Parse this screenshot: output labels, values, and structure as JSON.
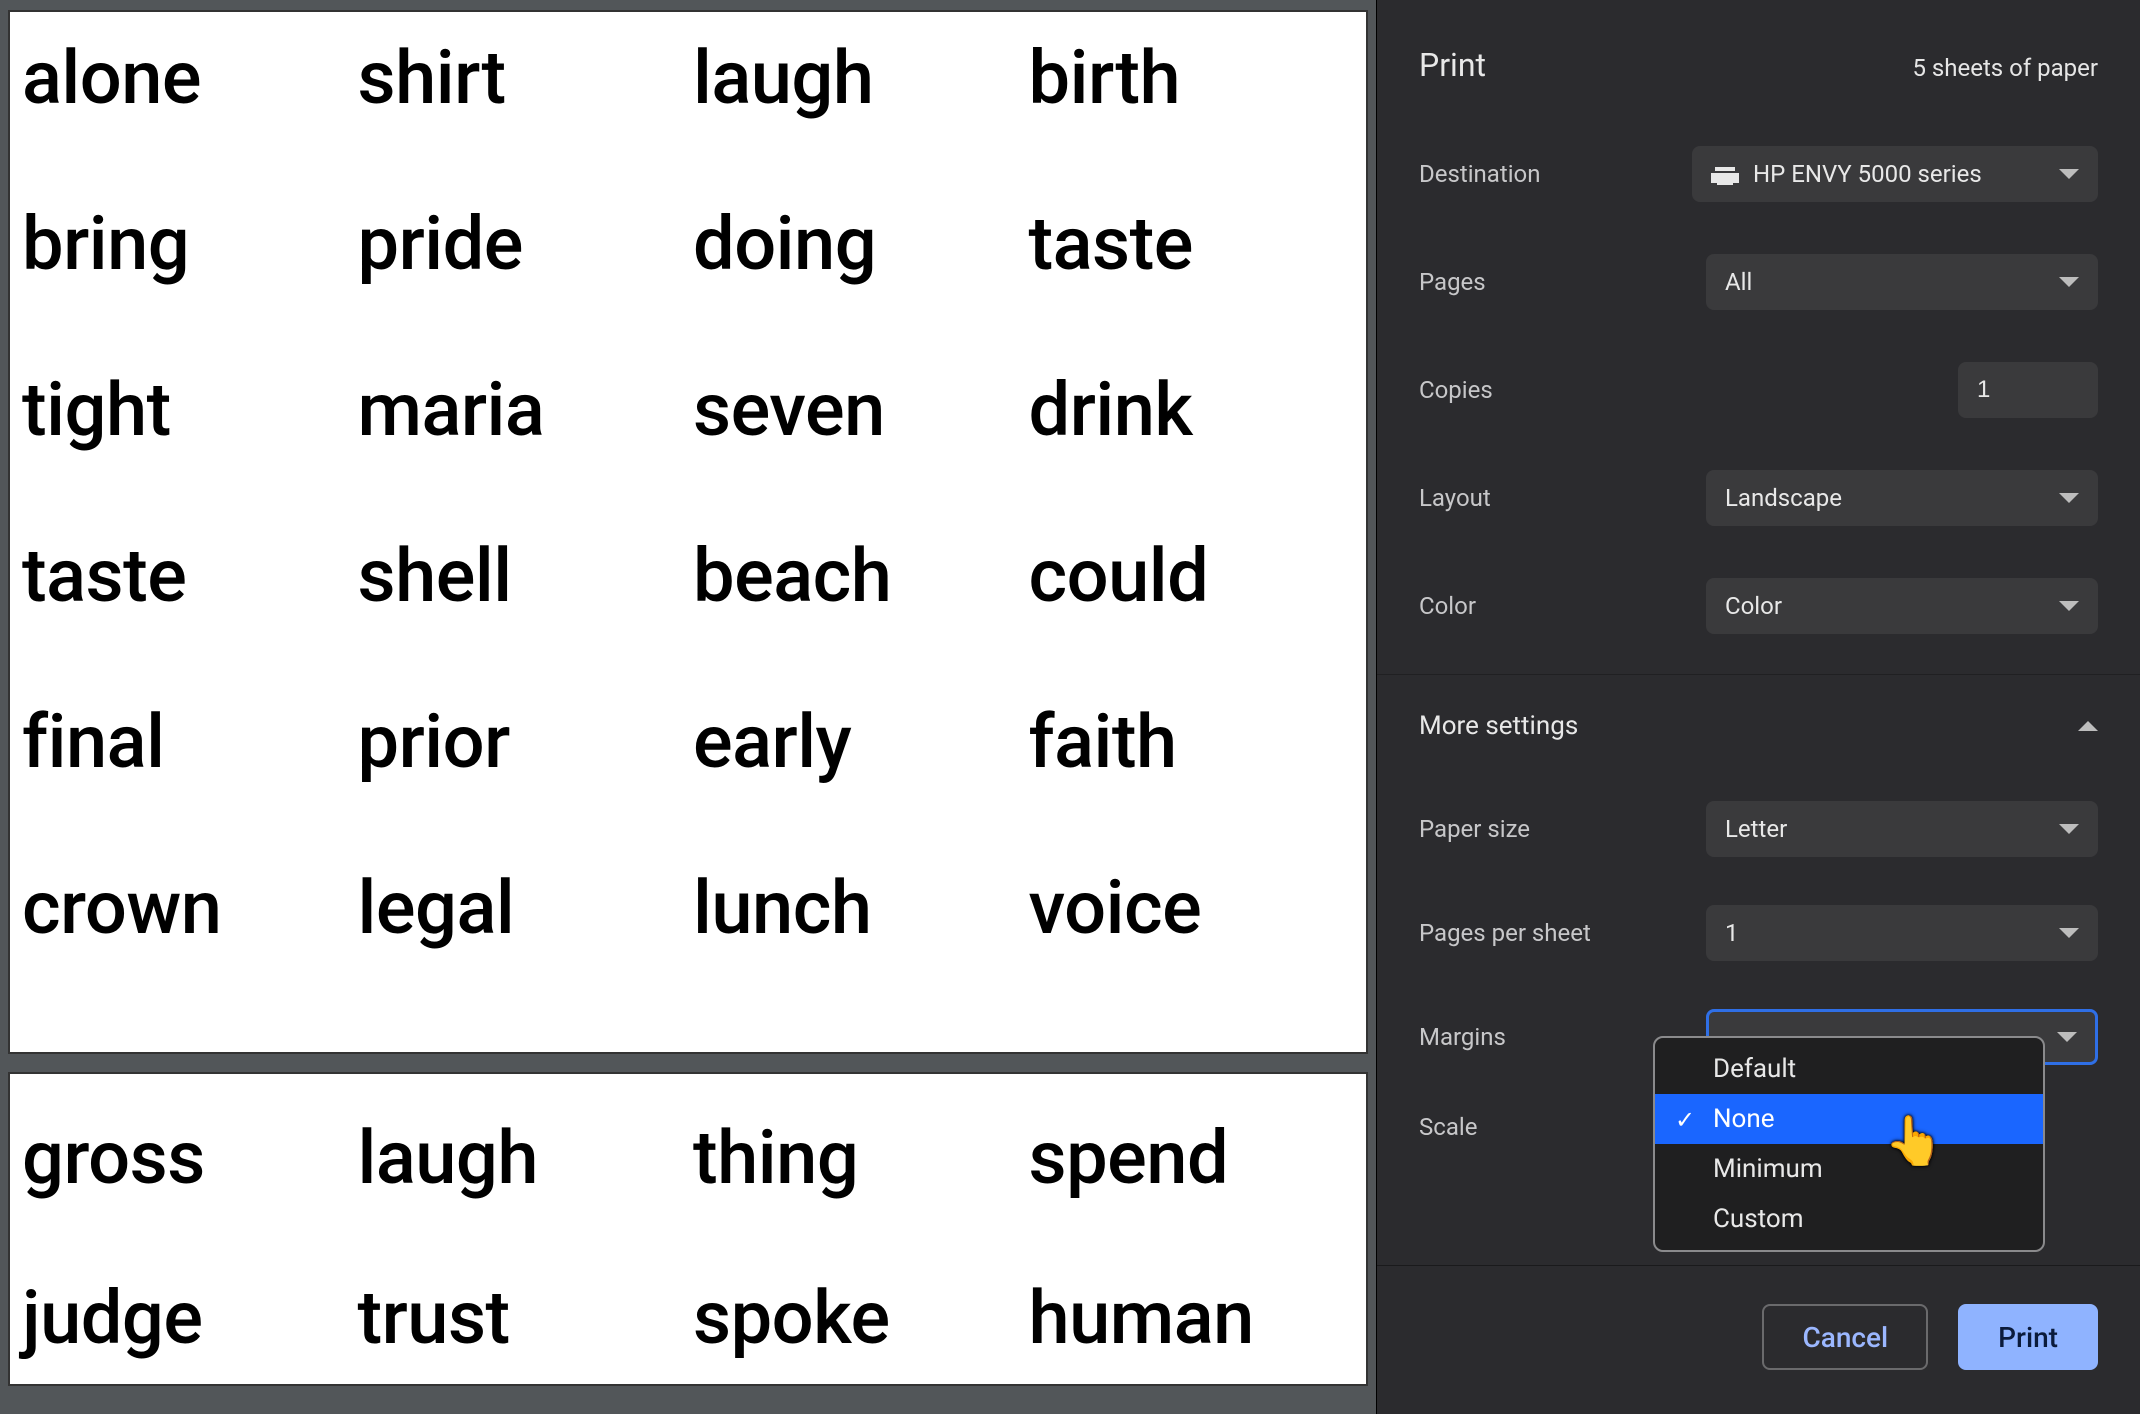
{
  "preview": {
    "pages": [
      [
        "alone",
        "shirt",
        "laugh",
        "birth",
        "bring",
        "pride",
        "doing",
        "taste",
        "tight",
        "maria",
        "seven",
        "drink",
        "taste",
        "shell",
        "beach",
        "could",
        "final",
        "prior",
        "early",
        "faith",
        "crown",
        "legal",
        "lunch",
        "voice"
      ],
      [
        "gross",
        "laugh",
        "thing",
        "spend",
        "judge",
        "trust",
        "spoke",
        "human"
      ]
    ]
  },
  "panel": {
    "title": "Print",
    "sheet_count": "5 sheets of paper",
    "rows": {
      "destination_label": "Destination",
      "destination_value": "HP ENVY 5000 series",
      "pages_label": "Pages",
      "pages_value": "All",
      "copies_label": "Copies",
      "copies_value": "1",
      "layout_label": "Layout",
      "layout_value": "Landscape",
      "color_label": "Color",
      "color_value": "Color",
      "more_settings": "More settings",
      "paper_size_label": "Paper size",
      "paper_size_value": "Letter",
      "pps_label": "Pages per sheet",
      "pps_value": "1",
      "margins_label": "Margins",
      "scale_label": "Scale"
    },
    "margins_options": [
      "Default",
      "None",
      "Minimum",
      "Custom"
    ],
    "margins_selected": "None",
    "footer": {
      "cancel": "Cancel",
      "print": "Print"
    }
  }
}
